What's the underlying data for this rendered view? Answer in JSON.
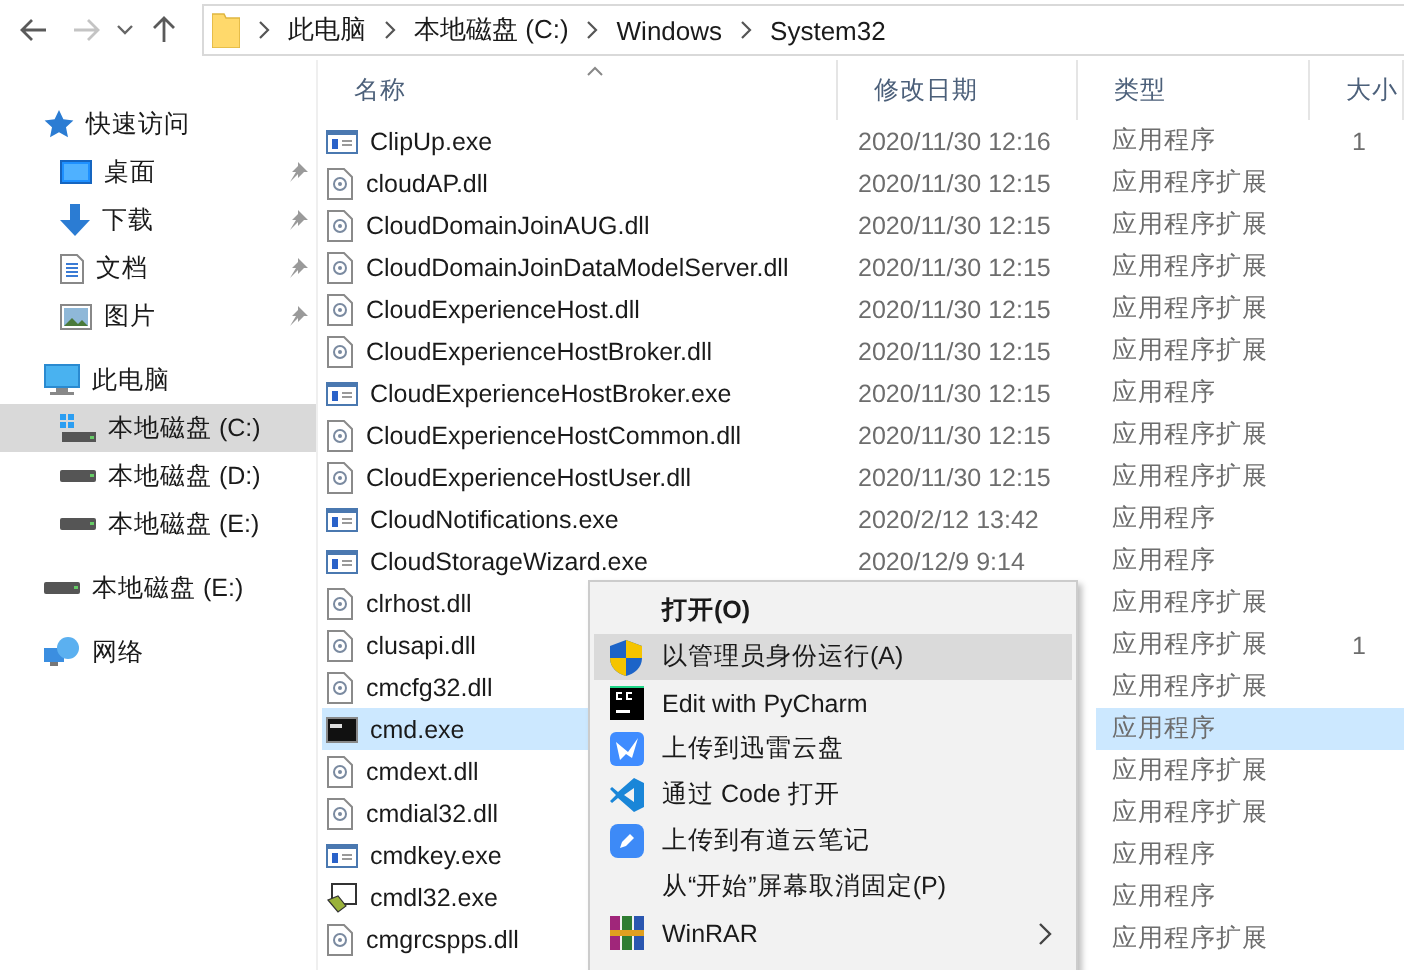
{
  "breadcrumbs": [
    "此电脑",
    "本地磁盘 (C:)",
    "Windows",
    "System32"
  ],
  "nav": {
    "forward_disabled": true
  },
  "sidebar": [
    {
      "label": "快速访问",
      "kind": "star",
      "children": [
        {
          "label": "桌面",
          "kind": "desktop",
          "pinned": true,
          "selected": false
        },
        {
          "label": "下载",
          "kind": "download",
          "pinned": true,
          "selected": false
        },
        {
          "label": "文档",
          "kind": "doc",
          "pinned": true,
          "selected": false
        },
        {
          "label": "图片",
          "kind": "pictures",
          "pinned": true,
          "selected": false
        }
      ]
    },
    {
      "label": "此电脑",
      "kind": "pc",
      "children": [
        {
          "label": "本地磁盘 (C:)",
          "kind": "sysdrive",
          "pinned": false,
          "selected": true
        },
        {
          "label": "本地磁盘 (D:)",
          "kind": "drive",
          "pinned": false,
          "selected": false
        },
        {
          "label": "本地磁盘 (E:)",
          "kind": "drive",
          "pinned": false,
          "selected": false
        }
      ]
    },
    {
      "label": "本地磁盘 (E:)",
      "kind": "drive"
    },
    {
      "label": "网络",
      "kind": "network"
    }
  ],
  "columns": [
    "名称",
    "修改日期",
    "类型",
    "大小"
  ],
  "rows": [
    {
      "name": "ClipUp.exe",
      "kind": "exe",
      "date": "2020/11/30 12:16",
      "type": "应用程序",
      "size": "1",
      "selected": false
    },
    {
      "name": "cloudAP.dll",
      "kind": "dll",
      "date": "2020/11/30 12:15",
      "type": "应用程序扩展",
      "selected": false
    },
    {
      "name": "CloudDomainJoinAUG.dll",
      "kind": "dll",
      "date": "2020/11/30 12:15",
      "type": "应用程序扩展",
      "selected": false
    },
    {
      "name": "CloudDomainJoinDataModelServer.dll",
      "kind": "dll",
      "date": "2020/11/30 12:15",
      "type": "应用程序扩展",
      "selected": false
    },
    {
      "name": "CloudExperienceHost.dll",
      "kind": "dll",
      "date": "2020/11/30 12:15",
      "type": "应用程序扩展",
      "selected": false
    },
    {
      "name": "CloudExperienceHostBroker.dll",
      "kind": "dll",
      "date": "2020/11/30 12:15",
      "type": "应用程序扩展",
      "selected": false
    },
    {
      "name": "CloudExperienceHostBroker.exe",
      "kind": "exe",
      "date": "2020/11/30 12:15",
      "type": "应用程序",
      "selected": false
    },
    {
      "name": "CloudExperienceHostCommon.dll",
      "kind": "dll",
      "date": "2020/11/30 12:15",
      "type": "应用程序扩展",
      "selected": false
    },
    {
      "name": "CloudExperienceHostUser.dll",
      "kind": "dll",
      "date": "2020/11/30 12:15",
      "type": "应用程序扩展",
      "selected": false
    },
    {
      "name": "CloudNotifications.exe",
      "kind": "exe",
      "date": "2020/2/12 13:42",
      "type": "应用程序",
      "selected": false
    },
    {
      "name": "CloudStorageWizard.exe",
      "kind": "exe",
      "date": "2020/12/9 9:14",
      "type": "应用程序",
      "selected": false
    },
    {
      "name": "clrhost.dll",
      "kind": "dll",
      "type": "应用程序扩展",
      "selected": false
    },
    {
      "name": "clusapi.dll",
      "kind": "dll",
      "type": "应用程序扩展",
      "size": "1",
      "selected": false
    },
    {
      "name": "cmcfg32.dll",
      "kind": "dll",
      "type": "应用程序扩展",
      "selected": false
    },
    {
      "name": "cmd.exe",
      "kind": "console",
      "type": "应用程序",
      "selected": true
    },
    {
      "name": "cmdext.dll",
      "kind": "dll",
      "type": "应用程序扩展",
      "selected": false
    },
    {
      "name": "cmdial32.dll",
      "kind": "dll",
      "type": "应用程序扩展",
      "selected": false
    },
    {
      "name": "cmdkey.exe",
      "kind": "exe",
      "type": "应用程序",
      "selected": false
    },
    {
      "name": "cmdl32.exe",
      "kind": "setup",
      "type": "应用程序",
      "selected": false
    },
    {
      "name": "cmgrcspps.dll",
      "kind": "dll",
      "type": "应用程序扩展",
      "selected": false
    }
  ],
  "context_menu": [
    {
      "label": "打开(O)",
      "kind": "plain",
      "default": true,
      "selected": false,
      "submenu": false
    },
    {
      "label": "以管理员身份运行(A)",
      "kind": "shield",
      "default": false,
      "selected": true,
      "submenu": false
    },
    {
      "label": "Edit with PyCharm",
      "kind": "pycharm",
      "default": false,
      "selected": false,
      "submenu": false
    },
    {
      "label": "上传到迅雷云盘",
      "kind": "xunlei",
      "default": false,
      "selected": false,
      "submenu": false
    },
    {
      "label": "通过 Code 打开",
      "kind": "vscode",
      "default": false,
      "selected": false,
      "submenu": false
    },
    {
      "label": "上传到有道云笔记",
      "kind": "youdao",
      "default": false,
      "selected": false,
      "submenu": false
    },
    {
      "label": "从“开始”屏幕取消固定(P)",
      "kind": "plain",
      "default": false,
      "selected": false,
      "submenu": false
    },
    {
      "label": "WinRAR",
      "kind": "winrar",
      "default": false,
      "selected": false,
      "submenu": true
    }
  ]
}
